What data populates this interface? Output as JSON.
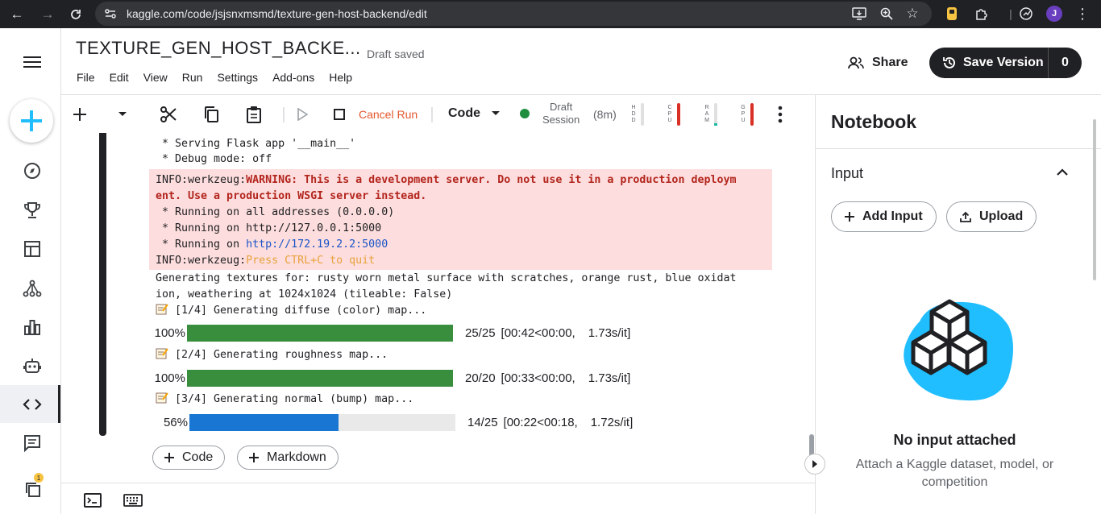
{
  "browser": {
    "url": "kaggle.com/code/jsjsnxmsmd/texture-gen-host-backend/edit",
    "profile_initial": "J"
  },
  "header": {
    "title": "TEXTURE_GEN_HOST_BACKE...",
    "status": "Draft saved",
    "share_label": "Share",
    "save_version_label": "Save Version",
    "save_version_count": "0"
  },
  "menu": [
    "File",
    "Edit",
    "View",
    "Run",
    "Settings",
    "Add-ons",
    "Help"
  ],
  "toolbar": {
    "cancel_run": "Cancel Run",
    "cell_type": "Code",
    "session_line1": "Draft",
    "session_line2": "Session",
    "session_time": "(8m)",
    "meters": [
      "HDD",
      "CPU",
      "RAM",
      "GPU"
    ]
  },
  "output": {
    "lines_plain_top": [
      " * Serving Flask app '__main__'",
      " * Debug mode: off"
    ],
    "stderr": {
      "prefix": "INFO:werkzeug:",
      "warning_line1": "WARNING: This is a development server. Do not use it in a production deploym",
      "warning_line2": "ent. Use a production WSGI server instead.",
      "running_all": " * Running on all addresses (0.0.0.0)",
      "running_local": " * Running on http://127.0.0.1:5000",
      "running_on": " * Running on ",
      "running_link": "http://172.19.2.2:5000",
      "prefix2": "INFO:werkzeug:",
      "quit": "Press CTRL+C to quit"
    },
    "gen_line1": "Generating textures for: rusty worn metal surface with scratches, orange rust, blue oxidat",
    "gen_line2": "ion, weathering at 1024x1024 (tileable: False)",
    "steps": [
      {
        "label": " [1/4] Generating diffuse (color) map...",
        "percent_text": "100%",
        "progress": 1.0,
        "count": "25/25",
        "time": "[00:42<00:00,",
        "rate": "1.73s/it]",
        "color": "#388e3c"
      },
      {
        "label": " [2/4] Generating roughness map...",
        "percent_text": "100%",
        "progress": 1.0,
        "count": "20/20",
        "time": "[00:33<00:00,",
        "rate": "1.73s/it]",
        "color": "#388e3c"
      },
      {
        "label": " [3/4] Generating normal (bump) map...",
        "percent_text": "56%",
        "progress": 0.56,
        "count": "14/25",
        "time": "[00:22<00:18,",
        "rate": "1.72s/it]",
        "color": "#1976d2"
      }
    ]
  },
  "add_cell": {
    "code_label": "Code",
    "markdown_label": "Markdown"
  },
  "panel": {
    "title": "Notebook",
    "input_heading": "Input",
    "add_input": "Add Input",
    "upload": "Upload",
    "empty_title": "No input attached",
    "empty_desc": "Attach a Kaggle dataset, model, or competition"
  },
  "left_nav": {
    "badge_count": "1"
  },
  "colors": {
    "accent_blue": "#20beff",
    "stderr_bg": "#fddddd",
    "cancel": "#e4572e"
  }
}
